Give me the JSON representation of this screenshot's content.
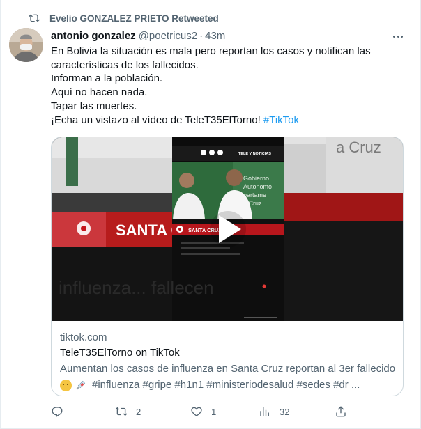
{
  "retweet": {
    "label": "Evelio GONZALEZ PRIETO Retweeted",
    "icon": "retweet-icon"
  },
  "tweet": {
    "name": "antonio gonzalez",
    "handle": "@poetricus2",
    "separator": "·",
    "time": "43m",
    "lines": [
      "En Bolivia la situación es mala pero reportan los casos y notifican las",
      "características de los fallecidos.",
      "Informan a la población.",
      "Aquí no hacen nada.",
      "Tapar las muertes."
    ],
    "last_line_text": "¡Echa un vistazo al vídeo de TeleT35ElTorno! ",
    "last_line_hashtag": "#TikTok"
  },
  "card": {
    "domain": "tiktok.com",
    "title": "TeleT35ElTorno on TikTok",
    "desc_line1": "Aumentan los casos de influenza en Santa Cruz reportan al 3er fallecido",
    "desc_line2": "#influenza #gripe #h1n1 #ministeriodesalud #sedes #dr ...",
    "video": {
      "left_banner": "SANTA C",
      "center_banner": "SANTA CRUZ",
      "header_text": "TELE Y NOTICIAS",
      "background_text": "a Cruz",
      "bottom_overlay": "influenza... fallecen",
      "sign_lines": [
        "Gobierno",
        "Autonomo",
        "partame",
        "a Cruz"
      ]
    }
  },
  "actions": {
    "reply": {
      "icon": "reply-icon",
      "count": ""
    },
    "retweet": {
      "icon": "retweet-icon",
      "count": "2"
    },
    "like": {
      "icon": "heart-icon",
      "count": "1"
    },
    "views": {
      "icon": "analytics-icon",
      "count": "32"
    },
    "share": {
      "icon": "share-icon",
      "count": ""
    }
  },
  "colors": {
    "accent": "#1d9bf0",
    "secondary_text": "#536471",
    "primary_text": "#0f1419",
    "card_border": "#cfd9de"
  }
}
